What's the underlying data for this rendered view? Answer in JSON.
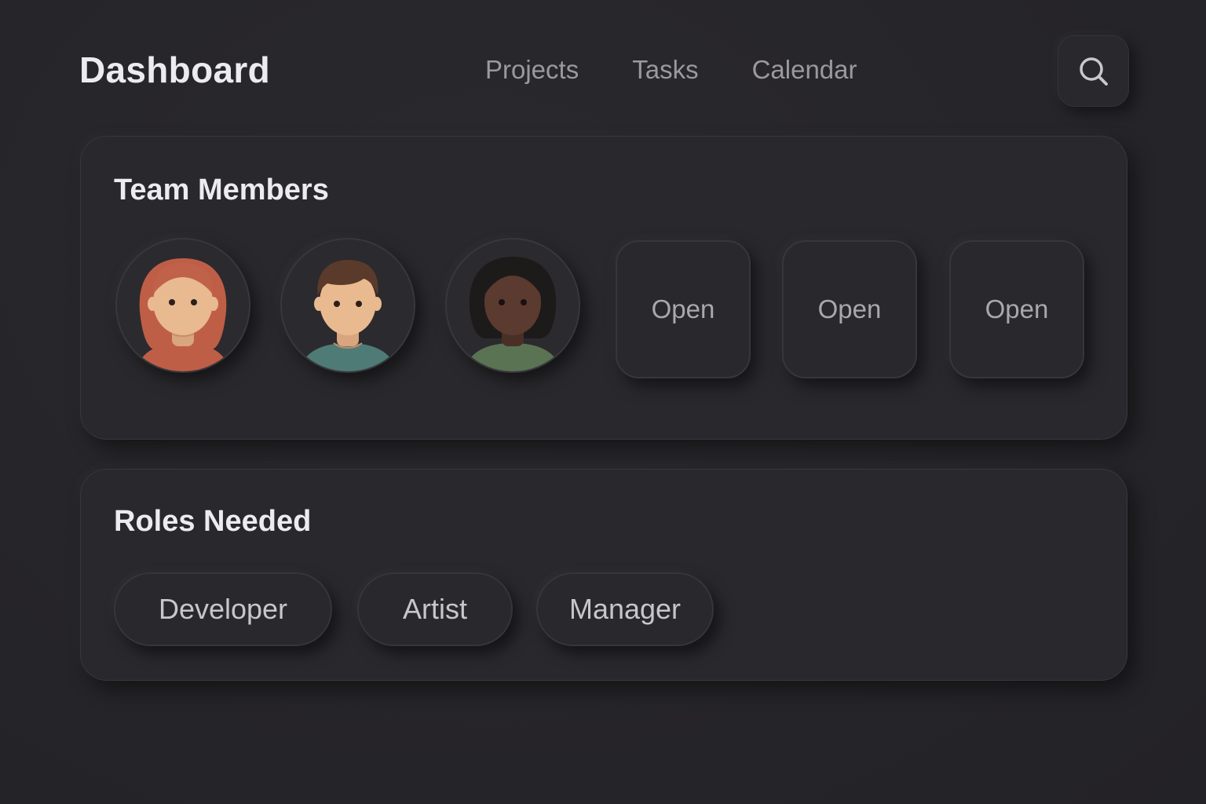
{
  "header": {
    "title": "Dashboard",
    "nav": [
      "Projects",
      "Tasks",
      "Calendar"
    ],
    "search_icon": "search-icon"
  },
  "team": {
    "title": "Team Members",
    "avatars": [
      {
        "icon": "avatar-woman-red-hair",
        "hair_color": "#c0614a",
        "shirt_color": "#bf5e47",
        "skin_color": "#e8b88f"
      },
      {
        "icon": "avatar-man-brown-hair",
        "hair_color": "#5a3a2a",
        "shirt_color": "#4f7b76",
        "skin_color": "#e8b88f"
      },
      {
        "icon": "avatar-woman-black-hair",
        "hair_color": "#1d1a1a",
        "shirt_color": "#5a7353",
        "skin_color": "#5a3a30"
      }
    ],
    "open_slots": [
      "Open",
      "Open",
      "Open"
    ]
  },
  "roles": {
    "title": "Roles Needed",
    "chips": [
      "Developer",
      "Artist",
      "Manager"
    ]
  },
  "colors": {
    "background": "#262529",
    "card": "#29282c",
    "text_primary": "#ececee",
    "text_secondary": "#9a999e"
  }
}
